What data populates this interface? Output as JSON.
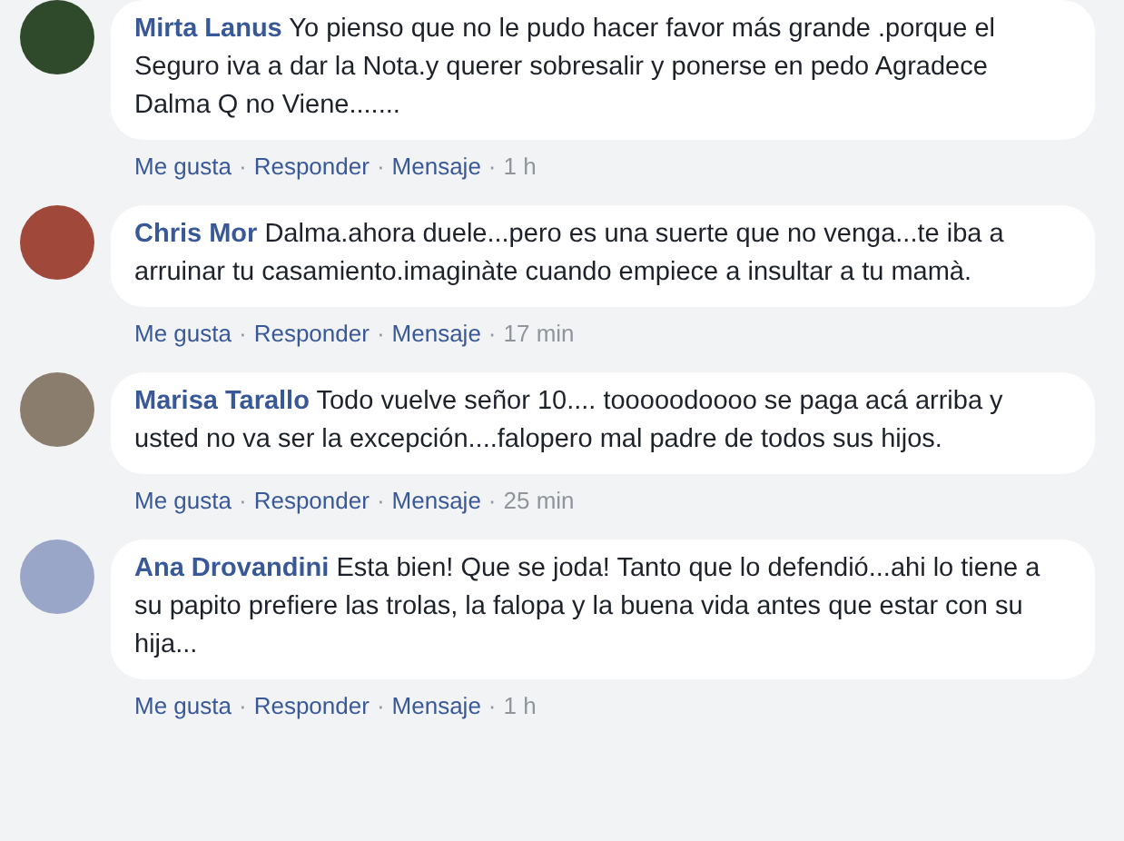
{
  "comments": [
    {
      "author": "Mirta Lanus",
      "text": "Yo pienso que no le pudo hacer favor más grande .porque el Seguro iva a dar la Nota.y querer sobresalir y ponerse en pedo Agradece Dalma Q no Viene.......",
      "actions": [
        "Me gusta",
        "Responder",
        "Mensaje"
      ],
      "time": "1 h"
    },
    {
      "author": "Chris Mor",
      "text": "Dalma.ahora duele...pero es una suerte que no venga...te iba a arruinar tu casamiento.imaginàte cuando empiece a insultar a tu mamà.",
      "actions": [
        "Me gusta",
        "Responder",
        "Mensaje"
      ],
      "time": "17 min"
    },
    {
      "author": "Marisa Tarallo",
      "text": "Todo vuelve señor 10.... tooooodoooo se paga acá arriba y usted no va ser la excepción....falopero mal padre de todos sus hijos.",
      "actions": [
        "Me gusta",
        "Responder",
        "Mensaje"
      ],
      "time": "25 min"
    },
    {
      "author": "Ana Drovandini",
      "text": "Esta bien! Que se joda! Tanto que lo defendió...ahi lo tiene a su papito prefiere las trolas, la falopa y la buena vida antes que estar con su hija...",
      "actions": [
        "Me gusta",
        "Responder",
        "Mensaje"
      ],
      "time": "1 h"
    }
  ],
  "separator": "·"
}
